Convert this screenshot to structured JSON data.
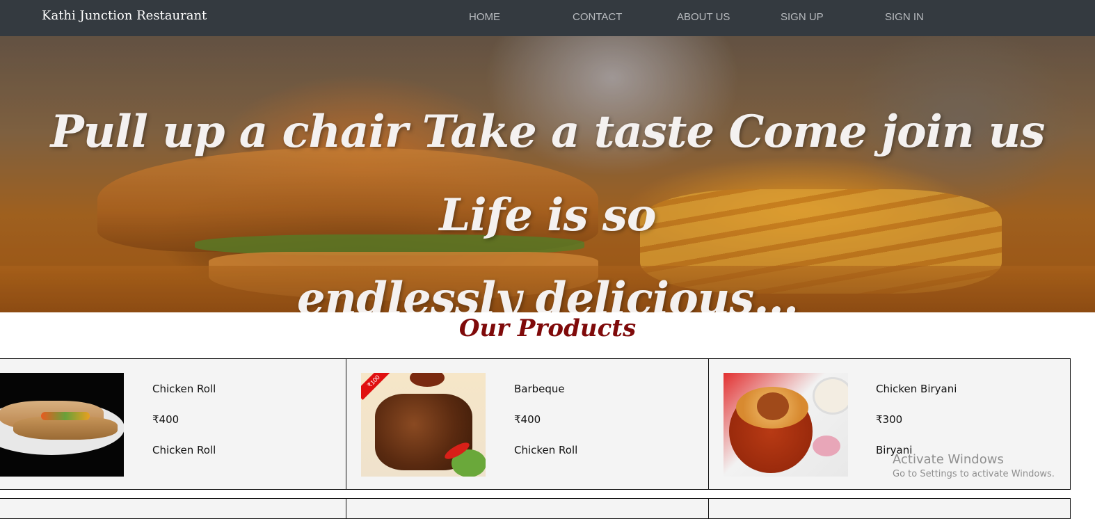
{
  "navbar": {
    "brand": "Kathi Junction Restaurant",
    "links": [
      "HOME",
      "CONTACT",
      "ABOUT US",
      "SIGN UP",
      "SIGN IN"
    ]
  },
  "hero": {
    "line1": "Pull up a chair Take a taste Come join us Life is so",
    "line2": "endlessly delicious..."
  },
  "products": {
    "title": "Our Products",
    "items": [
      {
        "name": "Chicken Roll",
        "price": "₹400",
        "category": "Chicken Roll",
        "image_icon": "chicken-roll-image"
      },
      {
        "name": "Barbeque",
        "price": "₹400",
        "category": "Chicken Roll",
        "image_icon": "barbeque-image"
      },
      {
        "name": "Chicken Biryani",
        "price": "₹300",
        "category": "Biryani",
        "image_icon": "chicken-biryani-image"
      }
    ],
    "barbeque_tag": "₹100"
  },
  "watermark": {
    "title": "Activate Windows",
    "subtitle": "Go to Settings to activate Windows."
  }
}
